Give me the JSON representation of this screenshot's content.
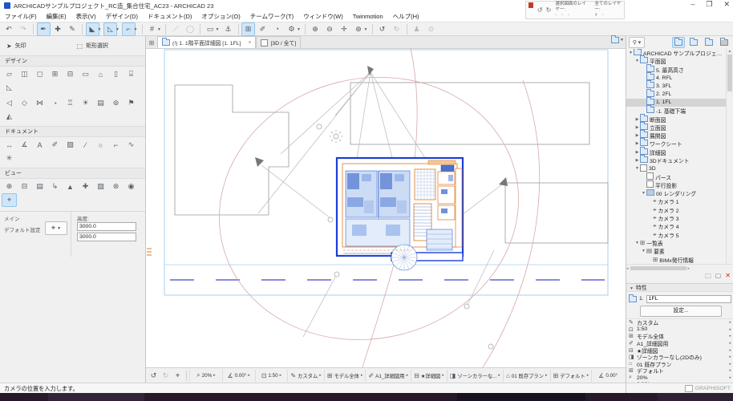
{
  "window": {
    "title": "ARCHICADサンプルプロジェクト_RC造_集合住宅_AC23 - ARCHICAD 23",
    "minimize": "–",
    "maximize": "❒",
    "close": "✕"
  },
  "menu": {
    "items": [
      "ファイル(F)",
      "編集(E)",
      "表示(V)",
      "デザイン(D)",
      "ドキュメント(D)",
      "オプション(O)",
      "チームワーク(T)",
      "ウィンドウ(W)",
      "Twinmotion",
      "ヘルプ(H)"
    ]
  },
  "layer_toolbar": {
    "selected_layers_label": "選択図面のレイヤー:",
    "all_layers_label": "全てのレイヤー:"
  },
  "toolbar": {
    "buttons": [
      {
        "name": "undo-icon",
        "glyph": "↶"
      },
      {
        "name": "redo-icon",
        "glyph": "↷",
        "disabled": true
      },
      {
        "sep": true
      },
      {
        "name": "adjust-pen-icon",
        "glyph": "✒",
        "active": true
      },
      {
        "name": "pickup-parameters-icon",
        "glyph": "✚"
      },
      {
        "name": "inject-parameters-icon",
        "glyph": "✎"
      },
      {
        "sep": true
      },
      {
        "name": "guide-lines-icon",
        "glyph": "◣",
        "active": true,
        "caret": true
      },
      {
        "name": "snap-guides-icon",
        "glyph": "◺",
        "active": true,
        "caret": true
      },
      {
        "name": "snap-points-icon",
        "glyph": "⌐",
        "active": true,
        "caret": true
      },
      {
        "sep": true
      },
      {
        "name": "grid-snap-icon",
        "glyph": "#",
        "caret": true
      },
      {
        "sep": true
      },
      {
        "name": "gravity-icon",
        "glyph": "⟋",
        "disabled": true
      },
      {
        "name": "relative-construction-icon",
        "glyph": "◯",
        "disabled": true
      },
      {
        "sep": true
      },
      {
        "name": "trace-reference-icon",
        "glyph": "▭",
        "caret": true
      },
      {
        "name": "anchor-icon",
        "glyph": "⚓"
      },
      {
        "sep": true
      },
      {
        "name": "marquee-mode-icon",
        "glyph": "⊞",
        "active": true
      },
      {
        "name": "edit-elements-icon",
        "glyph": "✐"
      },
      {
        "name": "arc-icon",
        "glyph": "◔"
      },
      {
        "name": "options-gear-icon",
        "glyph": "⚙",
        "caret": true
      },
      {
        "sep": true
      },
      {
        "name": "zoom-in-icon",
        "glyph": "⊕"
      },
      {
        "name": "zoom-out-icon",
        "glyph": "⊖"
      },
      {
        "name": "pan-icon",
        "glyph": "✛"
      },
      {
        "name": "zoom-options-icon",
        "glyph": "⊛",
        "caret": true
      },
      {
        "sep": true
      },
      {
        "name": "previous-view-icon",
        "glyph": "↺"
      },
      {
        "name": "next-view-icon",
        "glyph": "↻",
        "disabled": true
      },
      {
        "sep": true
      },
      {
        "name": "walk-mode-icon",
        "glyph": "♟",
        "disabled": true
      },
      {
        "name": "orbit-icon",
        "glyph": "⊙",
        "disabled": true
      }
    ]
  },
  "tabs": {
    "plan_tab": "(!) 1. 1階平面詳細図 [1. 1FL]",
    "close": "×",
    "tab3d": "[3D / 全て]"
  },
  "toolbox": {
    "arrow_label": "矢印",
    "marquee_label": "矩形選択",
    "design_header": "デザイン",
    "document_header": "ドキュメント",
    "view_header": "ビュー",
    "design_icons_row1": [
      {
        "name": "wall-icon",
        "glyph": "▱"
      },
      {
        "name": "door-icon",
        "glyph": "◫"
      },
      {
        "name": "window-icon",
        "glyph": "◻"
      },
      {
        "name": "column-icon",
        "glyph": "⊞"
      },
      {
        "name": "beam-icon",
        "glyph": "⊟"
      },
      {
        "name": "slab-icon",
        "glyph": "▭"
      },
      {
        "name": "roof-icon",
        "glyph": "⌂"
      },
      {
        "name": "object-icon",
        "glyph": "▯"
      },
      {
        "name": "stair-icon",
        "glyph": "⌸"
      },
      {
        "name": "ramp-icon",
        "glyph": "◺"
      }
    ],
    "design_icons_row2": [
      {
        "name": "zone-icon",
        "glyph": "◁"
      },
      {
        "name": "mesh-icon",
        "glyph": "◇"
      },
      {
        "name": "morph-icon",
        "glyph": "⋈"
      },
      {
        "name": "shell-icon",
        "glyph": "◔"
      },
      {
        "name": "railing-icon",
        "glyph": "♖"
      },
      {
        "name": "lamp-icon",
        "glyph": "☀"
      },
      {
        "name": "curtain-wall-icon",
        "glyph": "▤"
      },
      {
        "name": "skylight-icon",
        "glyph": "⊚"
      },
      {
        "name": "flag-icon",
        "glyph": "⚑"
      },
      {
        "name": "opening-icon",
        "glyph": "◭"
      }
    ],
    "document_icons": [
      {
        "name": "dimension-icon",
        "glyph": "↔"
      },
      {
        "name": "angle-dimension-icon",
        "glyph": "∡"
      },
      {
        "name": "text-icon",
        "glyph": "A"
      },
      {
        "name": "label-icon",
        "glyph": "✐"
      },
      {
        "name": "fill-icon",
        "glyph": "▨"
      },
      {
        "name": "line-icon",
        "glyph": "∕"
      },
      {
        "name": "circle-icon",
        "glyph": "○"
      },
      {
        "name": "polyline-icon",
        "glyph": "⌐"
      },
      {
        "name": "spline-icon",
        "glyph": "∿"
      },
      {
        "name": "hotspot-icon",
        "glyph": "✳"
      }
    ],
    "view_icons": [
      {
        "name": "section-icon",
        "glyph": "⊕"
      },
      {
        "name": "elevation-icon",
        "glyph": "⊟"
      },
      {
        "name": "interior-elevation-icon",
        "glyph": "▤"
      },
      {
        "name": "worksheet-icon",
        "glyph": "↳"
      },
      {
        "name": "detail-icon",
        "glyph": "▲"
      },
      {
        "name": "change-icon",
        "glyph": "✚"
      },
      {
        "name": "3d-document-icon",
        "glyph": "▧"
      },
      {
        "name": "camera-path-icon",
        "glyph": "⊛"
      },
      {
        "name": "axonometry-icon",
        "glyph": "◉"
      },
      {
        "name": "camera-icon",
        "glyph": "⌖",
        "active": true
      }
    ],
    "infobox": {
      "main_label": "メイン",
      "default_label": "デフォルト設定",
      "height_label": "高度:",
      "z1": "3000.0",
      "z2": "3000.0"
    }
  },
  "navigator": {
    "tree": [
      {
        "label": "ARCHICAD サンプルプロジェクト RC",
        "level": 0,
        "arrow": "v",
        "icon": "folder"
      },
      {
        "label": "平面図",
        "level": 1,
        "arrow": "v",
        "icon": "folder"
      },
      {
        "label": "5. 最高高さ",
        "level": 2,
        "arrow": "",
        "icon": "folder"
      },
      {
        "label": "4. RFL",
        "level": 2,
        "arrow": "",
        "icon": "folder"
      },
      {
        "label": "3. 3FL",
        "level": 2,
        "arrow": "",
        "icon": "folder"
      },
      {
        "label": "2. 2FL",
        "level": 2,
        "arrow": "",
        "icon": "folder"
      },
      {
        "label": "1. 1FL",
        "level": 2,
        "arrow": "",
        "icon": "folder",
        "selected": true
      },
      {
        "label": "-1. 基礎下端",
        "level": 2,
        "arrow": "",
        "icon": "folder"
      },
      {
        "label": "断面図",
        "level": 1,
        "arrow": ">",
        "icon": "folder"
      },
      {
        "label": "立面図",
        "level": 1,
        "arrow": ">",
        "icon": "folder"
      },
      {
        "label": "展開図",
        "level": 1,
        "arrow": ">",
        "icon": "folder"
      },
      {
        "label": "ワークシート",
        "level": 1,
        "arrow": ">",
        "icon": "folder"
      },
      {
        "label": "詳細図",
        "level": 1,
        "arrow": ">",
        "icon": "folder"
      },
      {
        "label": "3Dドキュメント",
        "level": 1,
        "arrow": ">",
        "icon": "folder"
      },
      {
        "label": "3D",
        "level": 1,
        "arrow": "v",
        "icon": "cube"
      },
      {
        "label": "パース",
        "level": 2,
        "arrow": "",
        "icon": "cube"
      },
      {
        "label": "平行投影",
        "level": 2,
        "arrow": "",
        "icon": "cube"
      },
      {
        "label": "00 レンダリング",
        "level": 2,
        "arrow": "v",
        "icon": "render"
      },
      {
        "label": "カメラ 1",
        "level": 3,
        "arrow": "",
        "icon": "camera"
      },
      {
        "label": "カメラ 2",
        "level": 3,
        "arrow": "",
        "icon": "camera"
      },
      {
        "label": "カメラ 3",
        "level": 3,
        "arrow": "",
        "icon": "camera"
      },
      {
        "label": "カメラ 4",
        "level": 3,
        "arrow": "",
        "icon": "camera"
      },
      {
        "label": "カメラ 5",
        "level": 3,
        "arrow": "",
        "icon": "camera"
      },
      {
        "label": "一覧表",
        "level": 1,
        "arrow": "v",
        "icon": "schedule"
      },
      {
        "label": "要素",
        "level": 2,
        "arrow": "v",
        "icon": "element-list"
      },
      {
        "label": "BIMx発行情報",
        "level": 3,
        "arrow": "",
        "icon": "schedule"
      }
    ],
    "properties": {
      "header": "特性",
      "story_no": "1.",
      "story_name": "1FL",
      "settings_label": "設定...",
      "items": [
        {
          "name": "pen-set-property",
          "icon": "✎",
          "label": "カスタム"
        },
        {
          "name": "scale-property",
          "icon": "⊡",
          "label": "1:50"
        },
        {
          "name": "structure-display-property",
          "icon": "⊞",
          "label": "モデル全体"
        },
        {
          "name": "pen-set-view-property",
          "icon": "✐",
          "label": "A1_詳細図用"
        },
        {
          "name": "layer-combination-property",
          "icon": "⊟",
          "label": "★詳細図"
        },
        {
          "name": "model-view-options-property",
          "icon": "◨",
          "label": "ゾーンカラーなし(2Dのみ)"
        },
        {
          "name": "renovation-filter-property",
          "icon": "⌂",
          "label": "01 既存プラン"
        },
        {
          "name": "graphic-override-property",
          "icon": "⊞",
          "label": "デフォルト"
        },
        {
          "name": "zoom-property",
          "icon": "⌕",
          "label": "20%"
        },
        {
          "name": "orientation-property",
          "icon": "∡",
          "label": "0.00°"
        }
      ]
    },
    "footer": "GRAPHISOFT"
  },
  "quick_options": {
    "items": [
      {
        "name": "zoom-option",
        "icon": "⌕",
        "label": "20%"
      },
      {
        "name": "orientation-option",
        "icon": "∡",
        "label": "0.00°"
      },
      {
        "name": "scale-option",
        "icon": "⊡",
        "label": "1:50"
      },
      {
        "name": "pen-set-option",
        "icon": "✎",
        "label": "カスタム"
      },
      {
        "name": "structure-display-option",
        "icon": "⊞",
        "label": "モデル全体"
      },
      {
        "name": "pen-set-view-option",
        "icon": "✐",
        "label": "A1_詳細図用"
      },
      {
        "name": "layer-combination-option",
        "icon": "⊟",
        "label": "★詳細図"
      },
      {
        "name": "model-view-option",
        "icon": "◨",
        "label": "ゾーンカラーな..."
      },
      {
        "name": "renovation-filter-option",
        "icon": "⌂",
        "label": "01 既存プラン"
      },
      {
        "name": "dimension-style-option",
        "icon": "⊞",
        "label": "デフォルト"
      },
      {
        "name": "rotation-option",
        "icon": "∡",
        "label": "0.00°",
        "noArrow": true
      }
    ]
  },
  "status_bar": {
    "message": "カメラの位置を入力します。"
  },
  "colors": {
    "accent": "#cfe6f8",
    "selection": "#d4d4d4",
    "plan_blue": "#1c3ed6",
    "plan_orange": "#e0771c",
    "camera_path": "#d8a8a8"
  }
}
